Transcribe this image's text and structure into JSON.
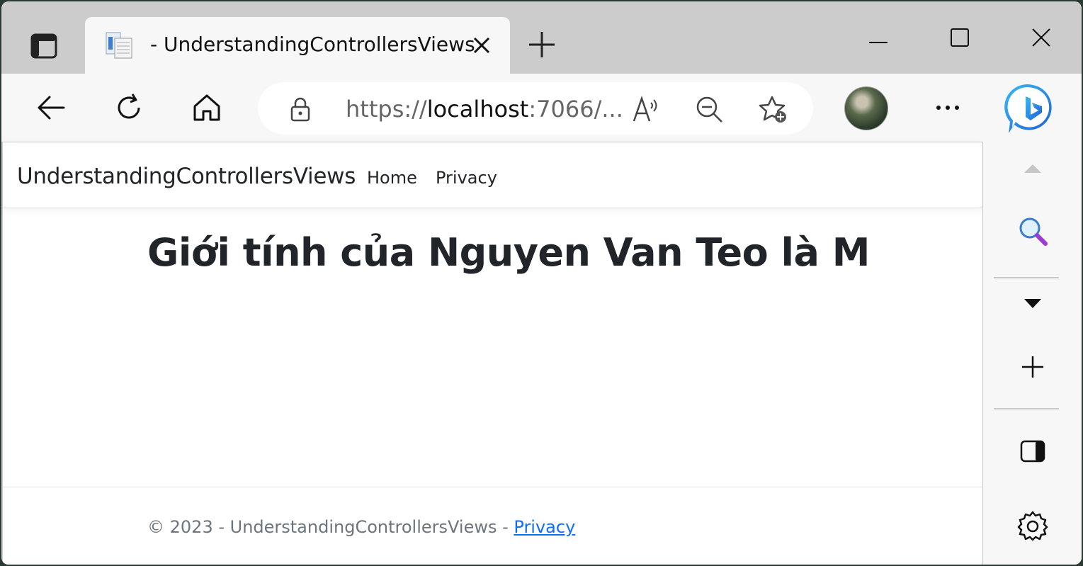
{
  "browser": {
    "tab": {
      "title": "- UnderstandingControllersViews"
    },
    "address_bar": {
      "url_prefix": "https://",
      "url_host": "localhost",
      "url_rest": ":7066/..."
    },
    "icons": {
      "tab_actions": "tab-actions-icon",
      "close_tab": "close-icon",
      "new_tab": "plus-icon",
      "back": "back-arrow-icon",
      "refresh": "refresh-icon",
      "home": "home-icon",
      "lock": "lock-icon",
      "read_aloud": "read-aloud-icon",
      "zoom_out": "zoom-out-icon",
      "add_favorite": "add-favorite-icon",
      "more": "more-icon",
      "copilot": "bing-copilot-icon"
    }
  },
  "page": {
    "brand": "UnderstandingControllersViews",
    "nav": [
      {
        "label": "Home"
      },
      {
        "label": "Privacy"
      }
    ],
    "heading": "Giới tính của Nguyen Van Teo là M",
    "footer": {
      "text": "© 2023 - UnderstandingControllersViews - ",
      "link": "Privacy"
    },
    "colors": {
      "text": "#212529",
      "muted": "#6c757d",
      "link": "#0d6efd"
    }
  },
  "sidebar": {
    "icons": [
      "scroll-up-icon",
      "search-icon",
      "dropdown-icon",
      "add-icon",
      "split-screen-icon",
      "settings-icon"
    ]
  }
}
